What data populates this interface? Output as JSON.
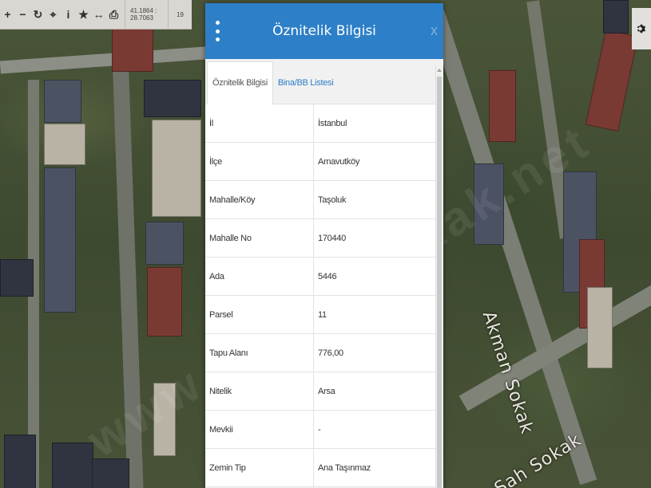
{
  "toolbar": {
    "buttons": [
      {
        "name": "zoom-in-icon",
        "glyph": "+"
      },
      {
        "name": "zoom-out-icon",
        "glyph": "−"
      },
      {
        "name": "refresh-icon",
        "glyph": "↻"
      },
      {
        "name": "locate-icon",
        "glyph": "⌖"
      },
      {
        "name": "info-icon",
        "glyph": "i"
      },
      {
        "name": "favorite-icon",
        "glyph": "★"
      },
      {
        "name": "measure-icon",
        "glyph": "↔"
      },
      {
        "name": "print-icon",
        "glyph": "⎙"
      }
    ],
    "coordinates": "41.1864 : 28.7063",
    "zoom_level": "19"
  },
  "map": {
    "street_label": "Akman Sokak",
    "street_label_2": "Şah Sokak",
    "watermark": "www.akmansokak.net"
  },
  "panel": {
    "title": "Öznitelik Bilgisi",
    "close_glyph": "x",
    "tabs": [
      {
        "label": "Öznitelik Bilgisi",
        "active": true
      },
      {
        "label": "Bina/BB Listesi",
        "active": false
      }
    ],
    "rows": [
      {
        "key": "İl",
        "value": "İstanbul"
      },
      {
        "key": "İlçe",
        "value": "Arnavutköy"
      },
      {
        "key": "Mahalle/Köy",
        "value": "Taşoluk"
      },
      {
        "key": "Mahalle No",
        "value": "170440"
      },
      {
        "key": "Ada",
        "value": "5446"
      },
      {
        "key": "Parsel",
        "value": "11"
      },
      {
        "key": "Tapu Alanı",
        "value": "776,00"
      },
      {
        "key": "Nitelik",
        "value": "Arsa"
      },
      {
        "key": "Mevkii",
        "value": "-"
      },
      {
        "key": "Zemin Tip",
        "value": "Ana Taşınmaz"
      }
    ]
  },
  "colors": {
    "header_blue": "#2d7fc7",
    "tab_link": "#2d7fc7"
  }
}
